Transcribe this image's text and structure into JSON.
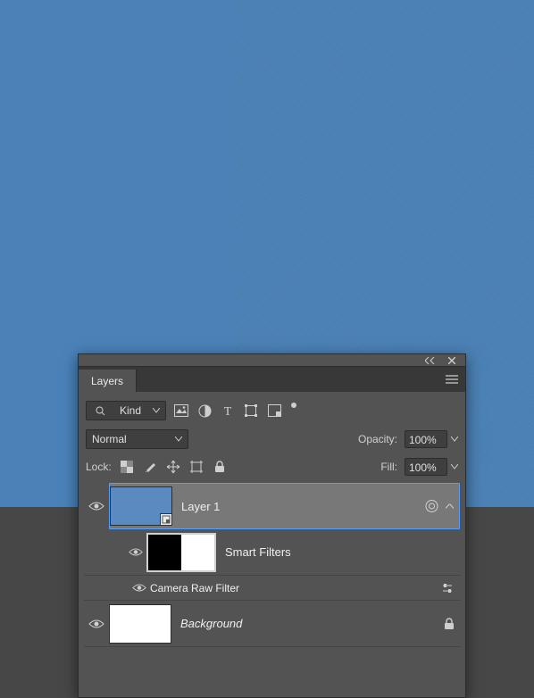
{
  "panel": {
    "title": "Layers"
  },
  "filter": {
    "kind_label": "Kind"
  },
  "blend": {
    "mode": "Normal",
    "opacity_label": "Opacity:",
    "opacity_value": "100%"
  },
  "lock": {
    "label": "Lock:",
    "fill_label": "Fill:",
    "fill_value": "100%"
  },
  "smart_filters_label": "Smart Filters",
  "layers": [
    {
      "name": "Layer 1",
      "filter_name": "Camera Raw Filter"
    },
    {
      "name": "Background"
    }
  ],
  "colors": {
    "panel_bg": "#535353",
    "selected_row": "#787878",
    "canvas_blue": "#4a82b8"
  }
}
